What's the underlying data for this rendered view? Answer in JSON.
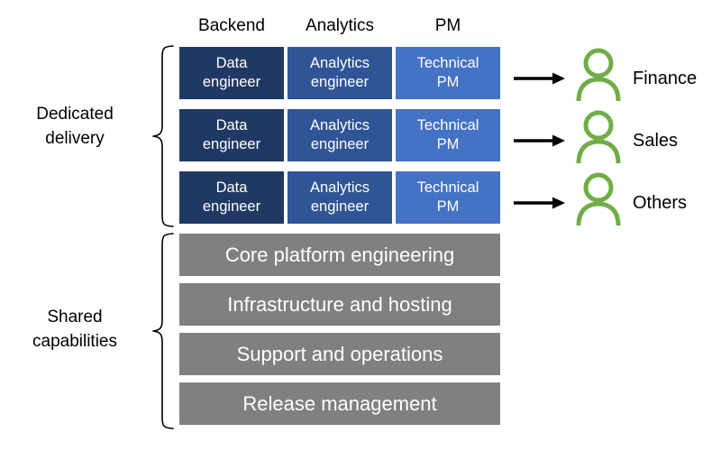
{
  "diagram": {
    "columns": [
      {
        "label": "Backend"
      },
      {
        "label": "Analytics"
      },
      {
        "label": "PM"
      }
    ],
    "sections": [
      {
        "key": "dedicated",
        "label_line1": "Dedicated",
        "label_line2": "delivery"
      },
      {
        "key": "shared",
        "label_line1": "Shared",
        "label_line2": "capabilities"
      }
    ],
    "roles": {
      "backend_line1": "Data",
      "backend_line2": "engineer",
      "analytics_line1": "Analytics",
      "analytics_line2": "engineer",
      "pm_line1": "Technical",
      "pm_line2": "PM"
    },
    "delivery_rows": [
      {
        "backend": "Data engineer",
        "analytics": "Analytics engineer",
        "pm": "Technical PM",
        "consumer": "Finance"
      },
      {
        "backend": "Data engineer",
        "analytics": "Analytics engineer",
        "pm": "Technical PM",
        "consumer": "Sales"
      },
      {
        "backend": "Data engineer",
        "analytics": "Analytics engineer",
        "pm": "Technical PM",
        "consumer": "Others"
      }
    ],
    "shared_capabilities": [
      {
        "label": "Core platform engineering"
      },
      {
        "label": "Infrastructure and hosting"
      },
      {
        "label": "Support and operations"
      },
      {
        "label": "Release management"
      }
    ],
    "colors": {
      "backend": "#203864",
      "analytics": "#2F5597",
      "pm": "#4472C4",
      "shared": "#808080",
      "consumer": "#70AD47",
      "arrow": "#000000",
      "text_light": "#FFFFFF",
      "text_dark": "#000000",
      "background": "#FFFFFF"
    }
  }
}
